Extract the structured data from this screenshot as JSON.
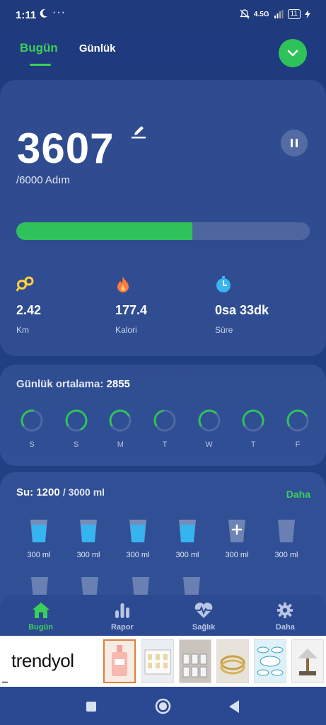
{
  "status": {
    "time": "1:11",
    "network": "4.5G",
    "battery": "11"
  },
  "tabs": {
    "today": "Bugün",
    "daily": "Günlük"
  },
  "summary": {
    "steps": "3607",
    "goal": "/6000 Adım",
    "progress_fraction": 0.601,
    "stats": [
      {
        "value": "2.42",
        "label": "Km",
        "icon": "distance-icon"
      },
      {
        "value": "177.4",
        "label": "Kalori",
        "icon": "flame-icon"
      },
      {
        "value": "0sa 33dk",
        "label": "Süre",
        "icon": "timer-icon"
      }
    ]
  },
  "average": {
    "label": "Günlük ortalama:",
    "value": "2855",
    "days": [
      {
        "label": "S",
        "fraction": 0.35
      },
      {
        "label": "S",
        "fraction": 0.75
      },
      {
        "label": "M",
        "fraction": 0.5
      },
      {
        "label": "T",
        "fraction": 0.3
      },
      {
        "label": "W",
        "fraction": 0.45
      },
      {
        "label": "T",
        "fraction": 0.65
      },
      {
        "label": "F",
        "fraction": 0.5
      }
    ]
  },
  "water": {
    "label": "Su:",
    "current": "1200",
    "total": "/ 3000 ml",
    "more": "Daha",
    "cup_amount": "300 ml"
  },
  "nav": {
    "today": "Bugün",
    "report": "Rapor",
    "health": "Sağlık",
    "more": "Daha"
  },
  "ad": {
    "brand": "trendyol"
  },
  "colors": {
    "accent": "#2fc25a",
    "background": "#1f3a7d",
    "water": "#35b4ef"
  }
}
